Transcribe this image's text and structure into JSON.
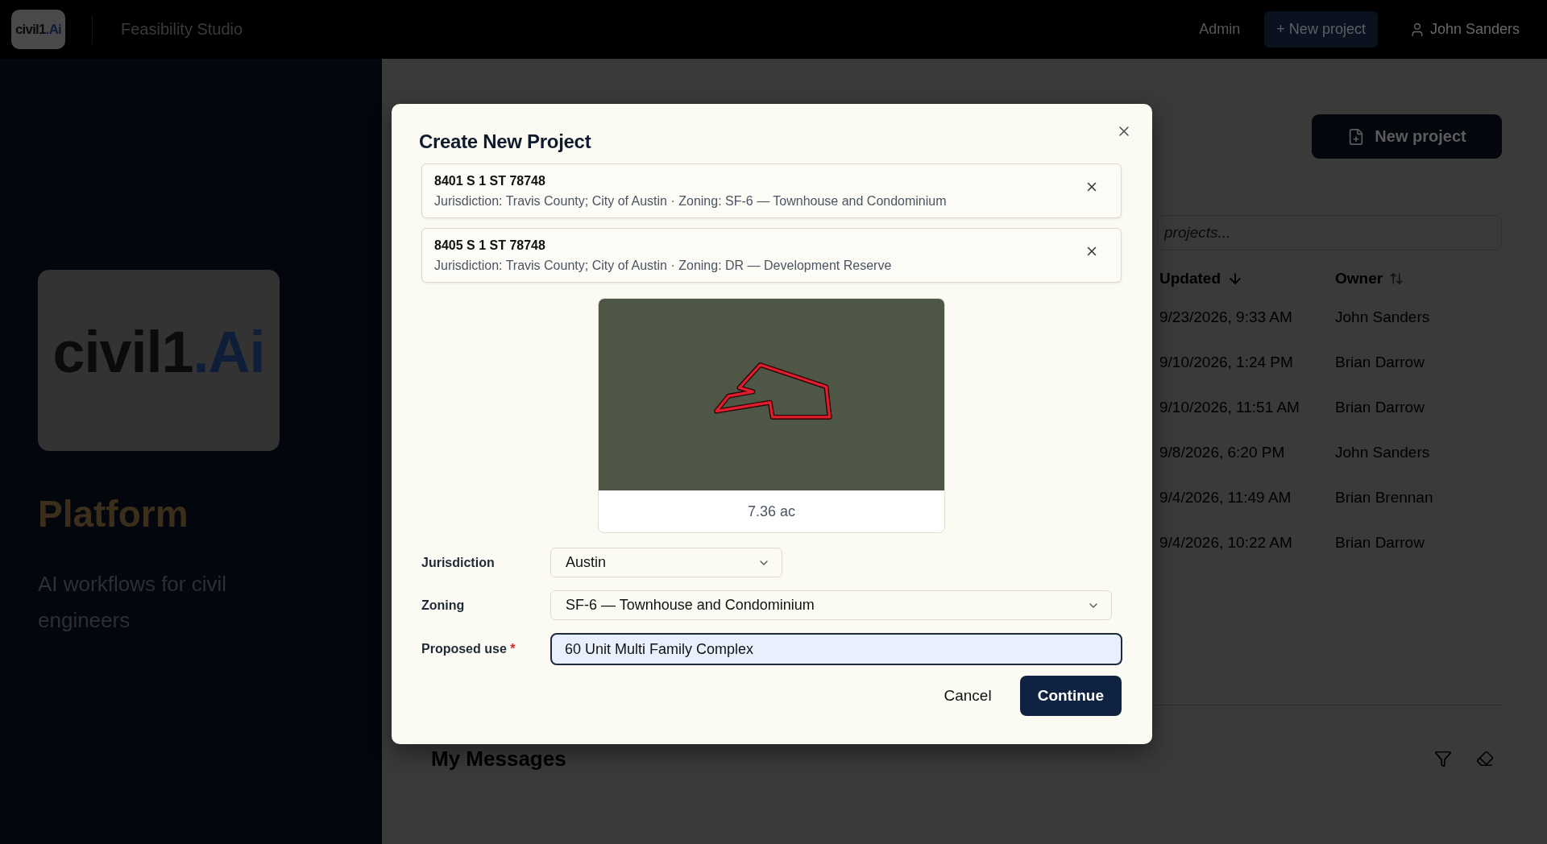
{
  "header": {
    "logo": {
      "text": "civil1",
      "accent": ".Ai"
    },
    "app_name": "Feasibility Studio",
    "nav": [
      {
        "kind": "link",
        "label": "Admin"
      },
      {
        "kind": "button",
        "label": "+ New project"
      },
      {
        "kind": "user",
        "label": "John Sanders"
      }
    ]
  },
  "sidebar": {
    "logo": {
      "text": "civil1",
      "accent": ".Ai"
    },
    "title": "Platform",
    "tagline": "AI workflows for civil engineers"
  },
  "projects": {
    "new_project_button": "New project",
    "search": {
      "placeholder": "projects..."
    },
    "columns": [
      {
        "label": "Updated",
        "sorted": true
      },
      {
        "label": "Owner",
        "sorted": false
      }
    ],
    "rows": [
      {
        "updated": "9/23/2026, 9:33 AM",
        "owner": "John Sanders"
      },
      {
        "updated": "9/10/2026, 1:24 PM",
        "owner": "Brian Darrow"
      },
      {
        "updated": "9/10/2026, 11:51 AM",
        "owner": "Brian Darrow"
      },
      {
        "updated": "9/8/2026, 6:20 PM",
        "owner": "John Sanders"
      },
      {
        "updated": "9/4/2026, 11:49 AM",
        "owner": "Brian Brennan"
      },
      {
        "updated": "9/4/2026, 10:22 AM",
        "owner": "Brian Darrow"
      }
    ]
  },
  "messages": {
    "title": "My Messages"
  },
  "dialog": {
    "title": "Create New Project",
    "parcels": [
      {
        "address": "8401 S 1 ST 78748",
        "details": "Jurisdiction: Travis County; City of Austin · Zoning: SF-6 — Townhouse and Condominium"
      },
      {
        "address": "8405 S 1 ST 78748",
        "details": "Jurisdiction: Travis County; City of Austin · Zoning: DR — Development Reserve"
      }
    ],
    "map": {
      "area": "7.36 ac"
    },
    "fields": [
      {
        "kind": "select",
        "label": "Jurisdiction",
        "value": "Austin"
      },
      {
        "kind": "select",
        "label": "Zoning",
        "value": "SF-6 — Townhouse and Condominium"
      },
      {
        "kind": "text",
        "label": "Proposed use",
        "required_mark": "*",
        "value": "60 Unit Multi Family Complex",
        "focused": true
      }
    ],
    "buttons": [
      {
        "kind": "secondary",
        "label": "Cancel"
      },
      {
        "kind": "primary",
        "label": "Continue"
      }
    ]
  }
}
